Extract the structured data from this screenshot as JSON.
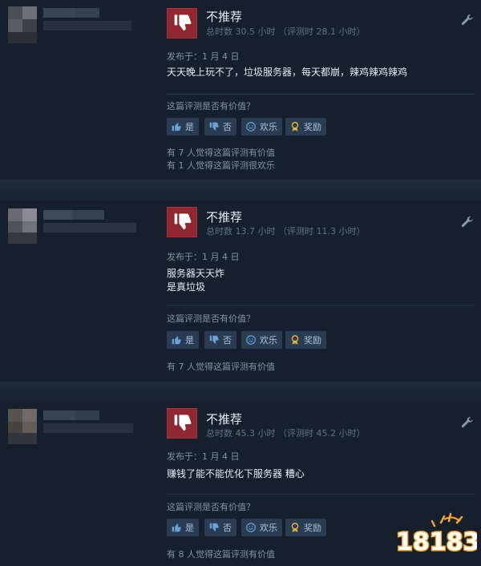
{
  "reviews": [
    {
      "verdict": "不推荐",
      "hours": "总时数 30.5 小时  （评测时 28.1 小时）",
      "posted": "发布于：1 月 4 日",
      "body": "天天晚上玩不了，垃圾服务器，每天都崩，辣鸡辣鸡辣鸡",
      "stats": [
        "有 7 人觉得这篇评测有价值",
        "有 1 人觉得这篇评测很欢乐"
      ]
    },
    {
      "verdict": "不推荐",
      "hours": "总时数 13.7 小时  （评测时 11.3 小时）",
      "posted": "发布于：1 月 4 日",
      "body": "服务器天天炸\n是真垃圾",
      "stats": [
        "有 7 人觉得这篇评测有价值"
      ]
    },
    {
      "verdict": "不推荐",
      "hours": "总时数 45.3 小时  （评测时 45.2 小时）",
      "posted": "发布于：1 月 4 日",
      "body": "赚钱了能不能优化下服务器 糟心",
      "stats": [
        "有 8 人觉得这篇评测有价值"
      ]
    }
  ],
  "helpful_prompt": "这篇评测是否有价值？",
  "buttons": {
    "yes": "是",
    "no": "否",
    "funny": "欢乐",
    "award": "奖励"
  },
  "watermark": "18183",
  "colors": {
    "background": "#16202d",
    "thumb_down_bg": "#8f2630",
    "button_bg": "#2a3c52",
    "logo_orange": "#f7a52b"
  }
}
